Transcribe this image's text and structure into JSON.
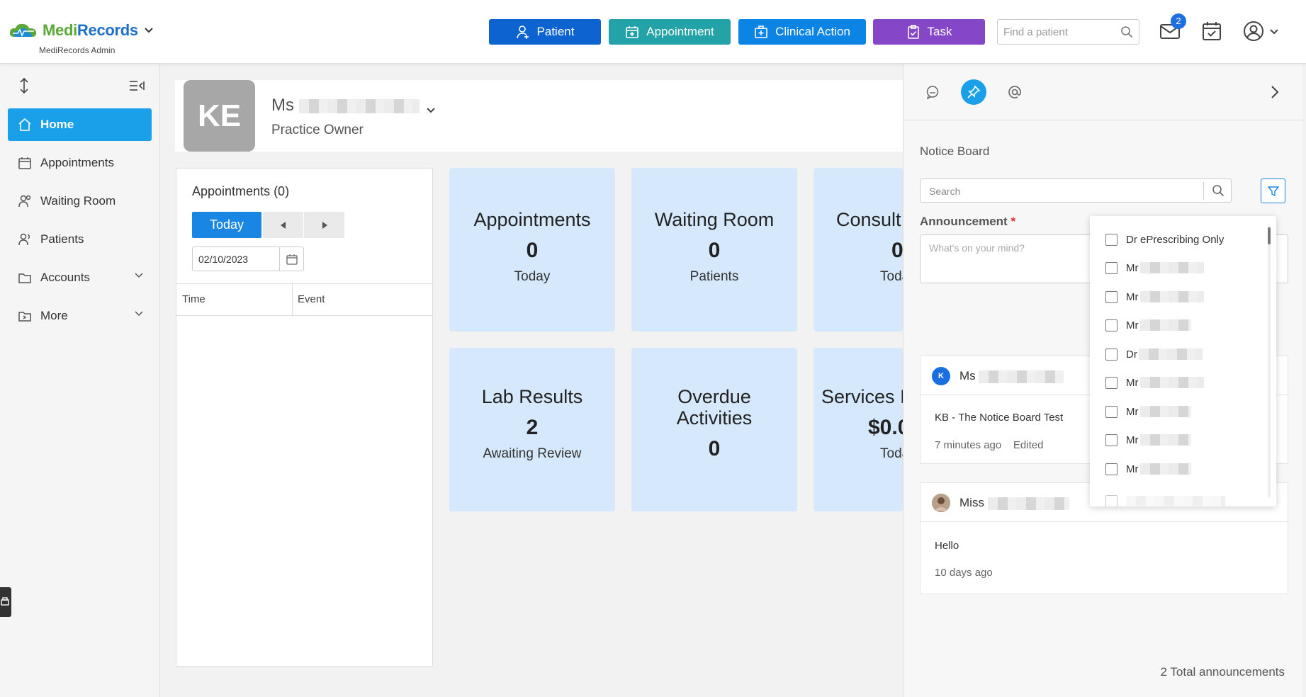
{
  "brand": {
    "name_part1": "Medi",
    "name_part2": "Records",
    "subtitle": "MediRecords Admin"
  },
  "header": {
    "buttons": [
      {
        "label": "Patient",
        "icon": "add-person-icon"
      },
      {
        "label": "Appointment",
        "icon": "calendar-plus-icon"
      },
      {
        "label": "Clinical Action",
        "icon": "medical-kit-icon"
      },
      {
        "label": "Task",
        "icon": "clipboard-icon"
      }
    ],
    "search_placeholder": "Find a patient",
    "mail_badge": "2"
  },
  "sidebar": {
    "items": [
      {
        "label": "Home",
        "icon": "home-icon",
        "active": true
      },
      {
        "label": "Appointments",
        "icon": "calendar-icon"
      },
      {
        "label": "Waiting Room",
        "icon": "people-icon"
      },
      {
        "label": "Patients",
        "icon": "patients-icon"
      },
      {
        "label": "Accounts",
        "icon": "folder-icon"
      },
      {
        "label": "More",
        "icon": "folder-arrow-icon"
      }
    ]
  },
  "user": {
    "initials": "KE",
    "prefix": "Ms",
    "role": "Practice Owner"
  },
  "appointments_panel": {
    "title": "Appointments (0)",
    "today_label": "Today",
    "date_value": "02/10/2023",
    "columns": [
      "Time",
      "Event"
    ]
  },
  "tiles": [
    {
      "title": "Appointments",
      "value": "0",
      "sub": "Today"
    },
    {
      "title": "Waiting Room",
      "value": "0",
      "sub": "Patients"
    },
    {
      "title": "Consult",
      "value": "0",
      "sub": "Toda"
    },
    {
      "title": "Lab Results",
      "value": "2",
      "sub": "Awaiting Review"
    },
    {
      "title": "Overdue Activities",
      "value": "0",
      "sub": ""
    },
    {
      "title": "Services I",
      "value": "$0.0",
      "sub": "Toda"
    }
  ],
  "notice_board": {
    "title": "Notice Board",
    "search_placeholder": "Search",
    "announcement_label": "Announcement",
    "required_mark": "*",
    "announcement_placeholder": "What's on your mind?",
    "cards": [
      {
        "initial": "K",
        "prefix": "Ms",
        "text": "KB - The Notice Board Test",
        "time": "7 minutes ago",
        "edited": "Edited"
      },
      {
        "initial": "",
        "prefix": "Miss",
        "text": "Hello",
        "time": "10 days ago",
        "edited": ""
      }
    ],
    "total": "2 Total announcements"
  },
  "filter_dropdown": {
    "options": [
      "Dr ePrescribing Only",
      "Mr",
      "Mr",
      "Mr",
      "Dr",
      "Mr",
      "Mr",
      "Mr",
      "Mr"
    ]
  },
  "colors": {
    "accent": "#1aa0e8",
    "tile_bg": "#d6e8fb",
    "patient_btn": "#0d63d0",
    "appt_btn": "#23a3a8",
    "clinical_btn": "#0c84e6",
    "task_btn": "#8547c8"
  }
}
